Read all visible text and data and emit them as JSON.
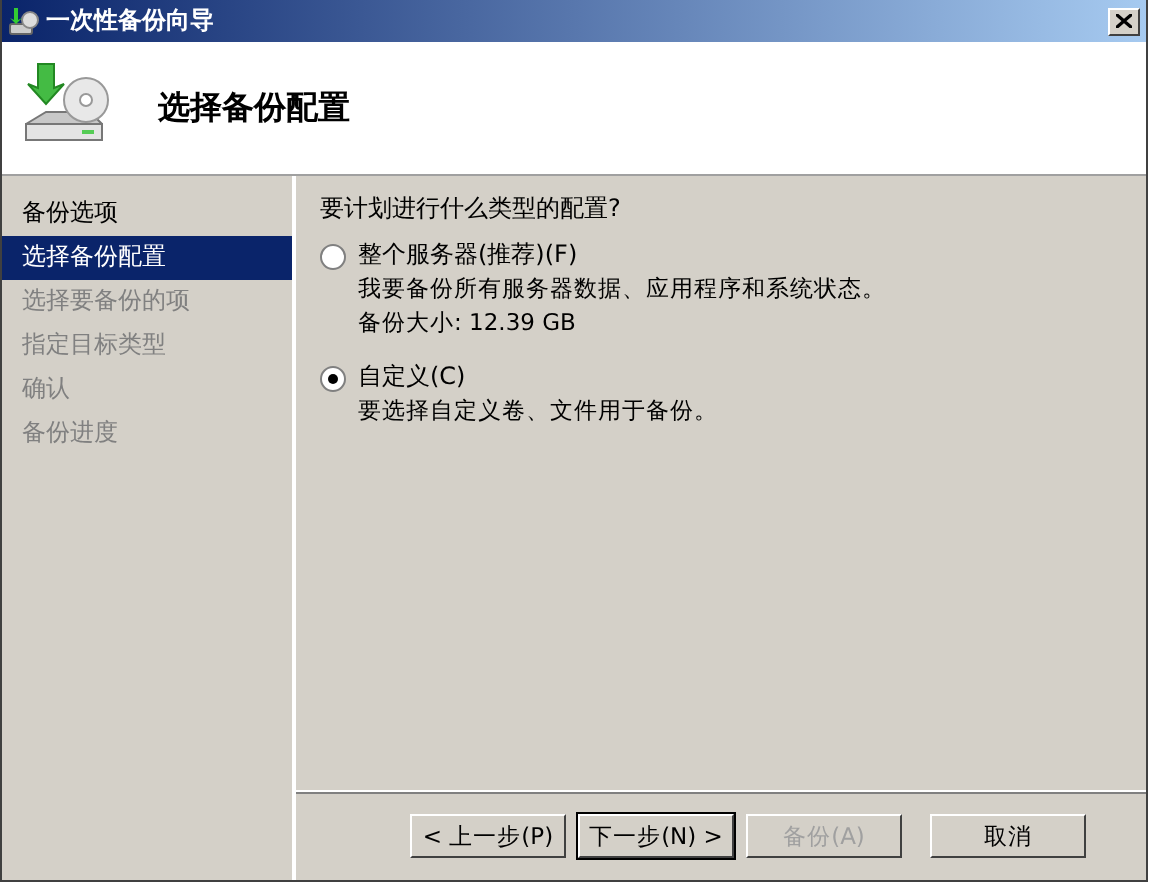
{
  "window": {
    "title": "一次性备份向导"
  },
  "header": {
    "title": "选择备份配置"
  },
  "sidebar": {
    "items": [
      {
        "label": "备份选项",
        "selected": false,
        "disabled": false
      },
      {
        "label": "选择备份配置",
        "selected": true,
        "disabled": false
      },
      {
        "label": "选择要备份的项",
        "selected": false,
        "disabled": true
      },
      {
        "label": "指定目标类型",
        "selected": false,
        "disabled": true
      },
      {
        "label": "确认",
        "selected": false,
        "disabled": true
      },
      {
        "label": "备份进度",
        "selected": false,
        "disabled": true
      }
    ]
  },
  "content": {
    "question": "要计划进行什么类型的配置?",
    "options": [
      {
        "label": "整个服务器(推荐)(F)",
        "selected": false,
        "description": "我要备份所有服务器数据、应用程序和系统状态。",
        "detail": "备份大小: 12.39 GB"
      },
      {
        "label": "自定义(C)",
        "selected": true,
        "description": "要选择自定义卷、文件用于备份。"
      }
    ]
  },
  "buttons": [
    {
      "label": "< 上一步(P)",
      "disabled": false,
      "default": false
    },
    {
      "label": "下一步(N) >",
      "disabled": false,
      "default": true
    },
    {
      "label": "备份(A)",
      "disabled": true,
      "default": false
    },
    {
      "label": "取消",
      "disabled": false,
      "default": false
    }
  ]
}
